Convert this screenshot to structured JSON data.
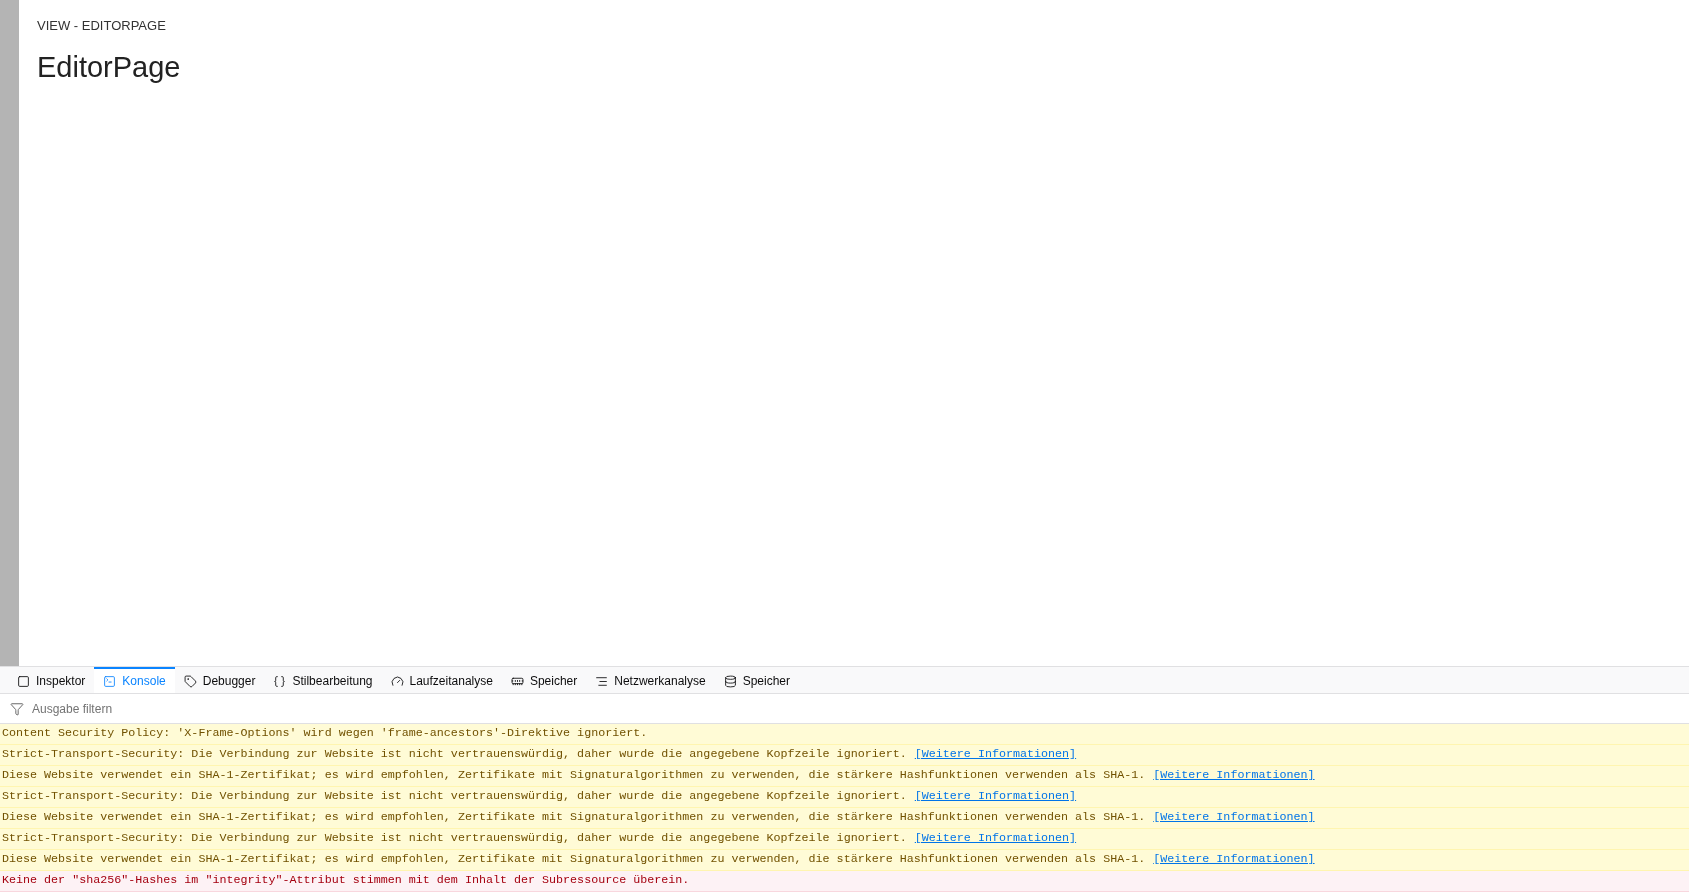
{
  "page": {
    "breadcrumb": "VIEW - EDITORPAGE",
    "title": "EditorPage"
  },
  "devtools": {
    "tabs": [
      {
        "label": "Inspektor",
        "selected": false
      },
      {
        "label": "Konsole",
        "selected": true
      },
      {
        "label": "Debugger",
        "selected": false
      },
      {
        "label": "Stilbearbeitung",
        "selected": false
      },
      {
        "label": "Laufzeitanalyse",
        "selected": false
      },
      {
        "label": "Speicher",
        "selected": false
      },
      {
        "label": "Netzwerkanalyse",
        "selected": false
      },
      {
        "label": "Speicher",
        "selected": false
      }
    ],
    "filter": {
      "placeholder": "Ausgabe filtern"
    },
    "messages": [
      {
        "kind": "warning",
        "text": "Content Security Policy: 'X-Frame-Options' wird wegen 'frame-ancestors'-Direktive ignoriert."
      },
      {
        "kind": "warning",
        "text": "Strict-Transport-Security: Die Verbindung zur Website ist nicht vertrauenswürdig, daher wurde die angegebene Kopfzeile ignoriert.",
        "link": "[Weitere Informationen]"
      },
      {
        "kind": "warning",
        "text": "Diese Website verwendet ein SHA-1-Zertifikat; es wird empfohlen, Zertifikate mit Signaturalgorithmen zu verwenden, die stärkere Hashfunktionen verwenden als SHA-1.",
        "link": "[Weitere Informationen]"
      },
      {
        "kind": "warning",
        "text": "Strict-Transport-Security: Die Verbindung zur Website ist nicht vertrauenswürdig, daher wurde die angegebene Kopfzeile ignoriert.",
        "link": "[Weitere Informationen]"
      },
      {
        "kind": "warning",
        "text": "Diese Website verwendet ein SHA-1-Zertifikat; es wird empfohlen, Zertifikate mit Signaturalgorithmen zu verwenden, die stärkere Hashfunktionen verwenden als SHA-1.",
        "link": "[Weitere Informationen]"
      },
      {
        "kind": "warning",
        "text": "Strict-Transport-Security: Die Verbindung zur Website ist nicht vertrauenswürdig, daher wurde die angegebene Kopfzeile ignoriert.",
        "link": "[Weitere Informationen]"
      },
      {
        "kind": "warning",
        "text": "Diese Website verwendet ein SHA-1-Zertifikat; es wird empfohlen, Zertifikate mit Signaturalgorithmen zu verwenden, die stärkere Hashfunktionen verwenden als SHA-1.",
        "link": "[Weitere Informationen]"
      },
      {
        "kind": "error",
        "text": "Keine der \"sha256\"-Hashes im \"integrity\"-Attribut stimmen mit dem Inhalt der Subressource überein."
      }
    ]
  }
}
